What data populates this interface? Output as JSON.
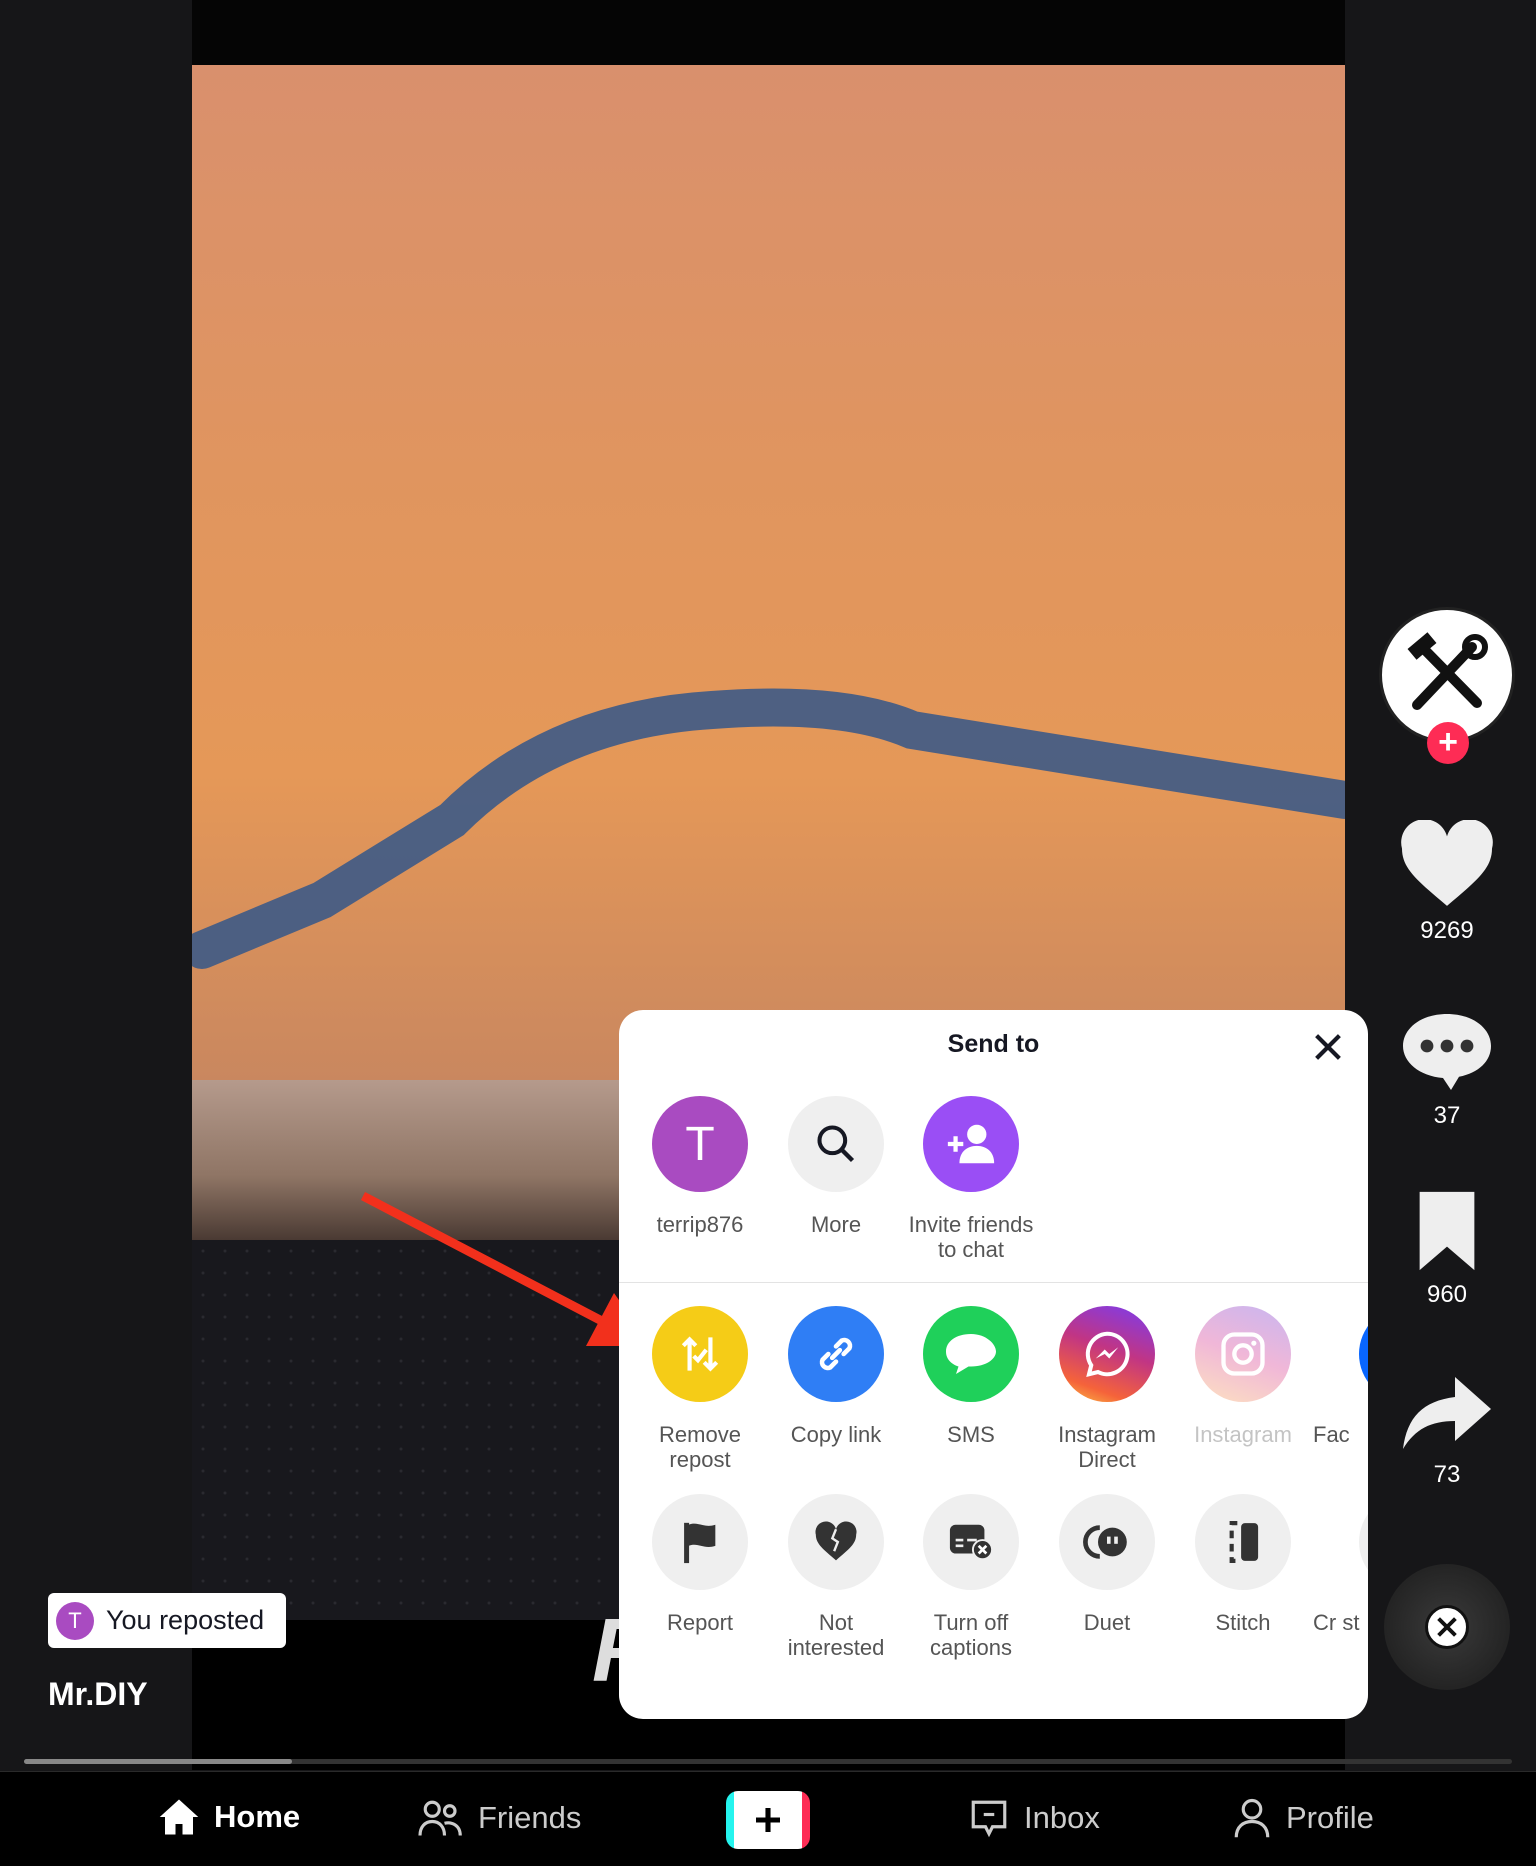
{
  "video": {
    "overlay_text": "F"
  },
  "sidebar": {
    "likes": "9269",
    "comments": "37",
    "saves": "960",
    "shares": "73"
  },
  "repost_badge": {
    "avatar_letter": "T",
    "text": "You reposted"
  },
  "author": "Mr.DIY",
  "progress": 0.18,
  "share_panel": {
    "title": "Send to",
    "contacts": [
      {
        "label": "terrip876",
        "avatar_letter": "T",
        "color": "#a94bc1"
      },
      {
        "label": "More",
        "icon": "search-icon"
      },
      {
        "label": "Invite friends to chat",
        "icon": "add-person-icon",
        "color": "#9a4ef5"
      }
    ],
    "share_targets": [
      {
        "label": "Remove repost",
        "icon": "repost-icon",
        "color": "#f5cc17"
      },
      {
        "label": "Copy link",
        "icon": "link-icon",
        "color": "#2f7ef5"
      },
      {
        "label": "SMS",
        "icon": "message-bubble-icon",
        "color": "#1fd05a"
      },
      {
        "label": "Instagram Direct",
        "icon": "messenger-icon",
        "color": "#c13584"
      },
      {
        "label": "Instagram",
        "icon": "instagram-icon",
        "color": "#f0b7d8"
      },
      {
        "label": "Fac",
        "icon": "facebook-icon",
        "color": "#0866ff"
      }
    ],
    "actions": [
      {
        "label": "Report",
        "icon": "flag-icon"
      },
      {
        "label": "Not interested",
        "icon": "broken-heart-icon"
      },
      {
        "label": "Turn off captions",
        "icon": "captions-off-icon"
      },
      {
        "label": "Duet",
        "icon": "duet-icon"
      },
      {
        "label": "Stitch",
        "icon": "stitch-icon"
      },
      {
        "label": "Cr st",
        "icon": "create-sticker-icon"
      }
    ]
  },
  "nav": {
    "home": "Home",
    "friends": "Friends",
    "inbox": "Inbox",
    "profile": "Profile"
  },
  "colors": {
    "accent": "#fe2c55",
    "arrow": "#f2301c"
  }
}
